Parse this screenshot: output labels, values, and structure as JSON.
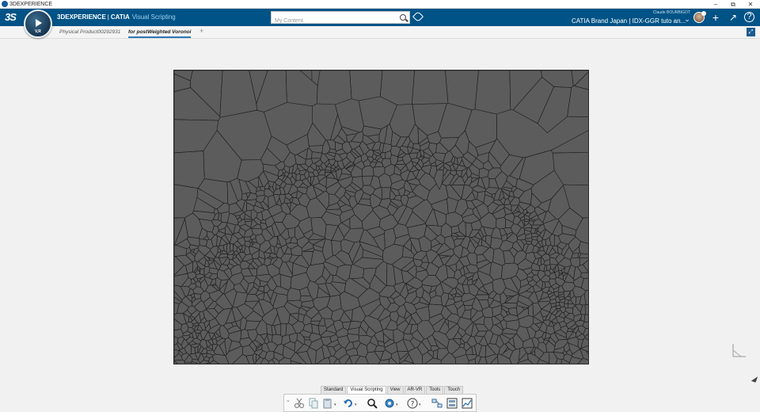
{
  "os": {
    "title": "3DEXPERIENCE",
    "minimize": "–",
    "restore": "⧉",
    "close": "✕"
  },
  "header": {
    "brand_platform": "3DEXPERIENCE",
    "brand_separator": "|",
    "brand_product": "CATIA",
    "brand_app": "Visual Scripting",
    "compass_label": "V,R",
    "search_placeholder": "My Content",
    "user_name": "Claude BOURBIGOT",
    "context": "CATIA Brand Japan | IDX-GGR tuto an...",
    "context_chevron": "⌄",
    "add_label": "+",
    "share_label": "↗",
    "help_label": "?"
  },
  "tabs": [
    {
      "label": "Physical Product00292931",
      "active": false
    },
    {
      "label": "for postWeighted Voronoi",
      "active": true
    }
  ],
  "tab_add": "+",
  "fit_label": "⤢",
  "action_bar": {
    "tabs": [
      "Standard",
      "Visual Scripting",
      "View",
      "AR-VR",
      "Tools",
      "Touch"
    ],
    "active_tab": "Visual Scripting",
    "handle": "⌄"
  },
  "colors": {
    "topbar": "#005386",
    "canvas": "#5c5c5c",
    "cell_edge": "#1a1a1a",
    "tab_underline": "#2b78b6"
  },
  "icons": {
    "app": "3dexperience-app-icon",
    "search": "search-icon",
    "tag": "tag-icon",
    "compass": "compass-icon"
  }
}
